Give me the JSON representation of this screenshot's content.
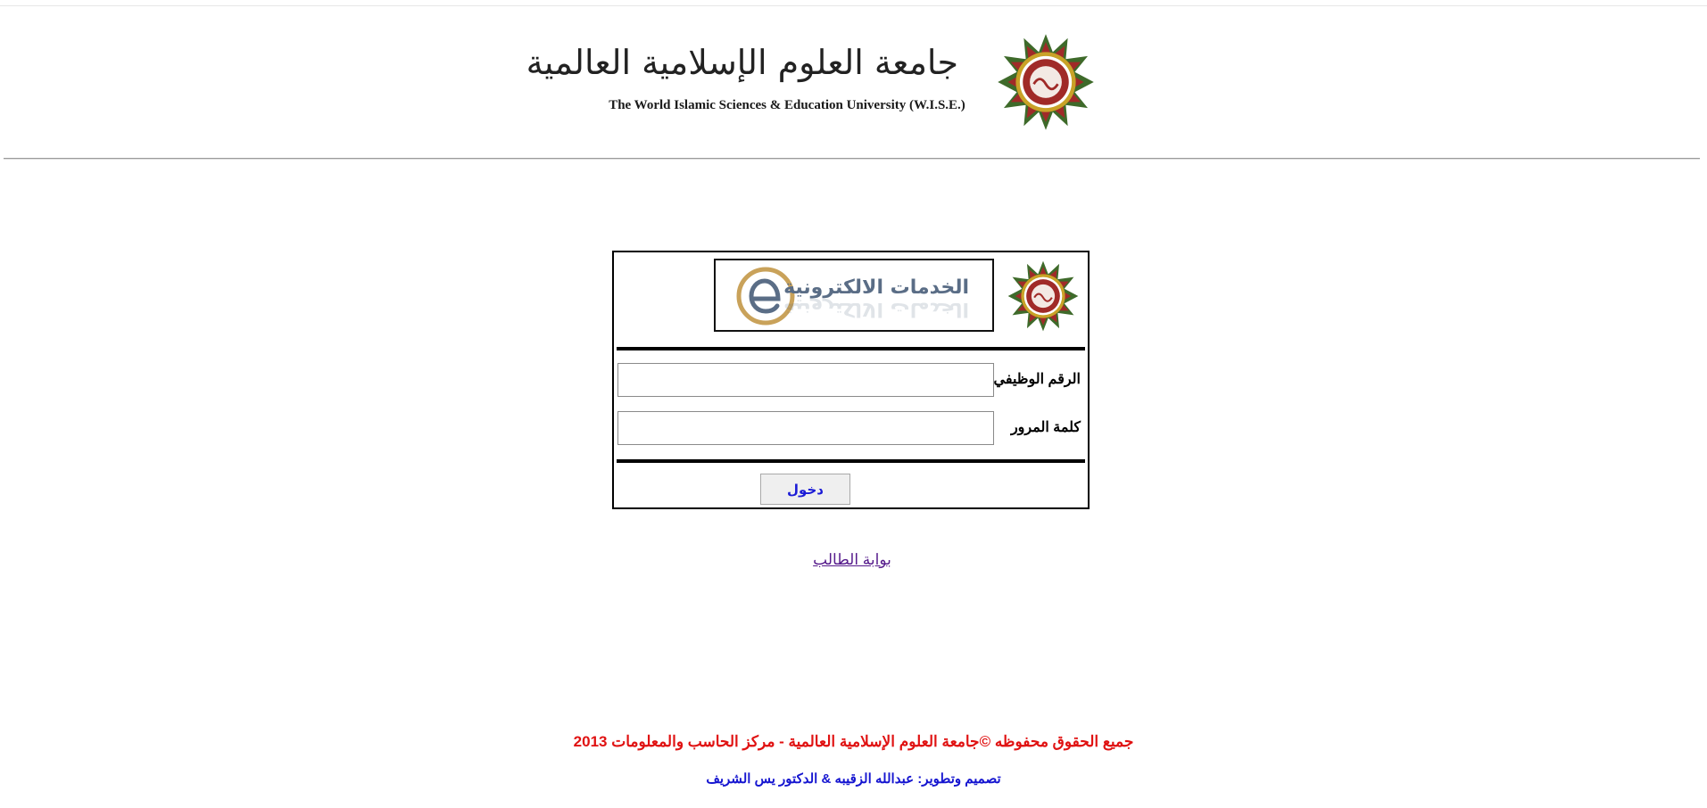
{
  "header": {
    "title_ar": "جامعة العلوم الإسلامية العالمية",
    "title_en": "The World Islamic Sciences & Education University (W.I.S.E.)",
    "seal_icon": "university-seal-icon"
  },
  "login": {
    "banner_text": "الخدمات الالكترونية",
    "banner_icon": "e-services-icon",
    "employee_id_label": "الرقم الوظيفي",
    "employee_id_value": "",
    "password_label": "كلمة المرور",
    "password_value": "",
    "submit_label": "دخول"
  },
  "links": {
    "student_portal": "بوابة الطالب"
  },
  "footer": {
    "copyright": "جميع الحقوق محفوظه ©جامعة العلوم الإسلامية العالمية - مركز الحاسب والمعلومات 2013",
    "credits": "تصميم وتطوير: عبدالله الزقيبه & الدكتور يس الشريف"
  },
  "colors": {
    "seal_green": "#3e6a2a",
    "seal_red": "#a02a28",
    "seal_gold": "#c9a227",
    "banner_text": "#5a6d86",
    "link": "#551a8b",
    "footer_red": "#e01212",
    "footer_blue": "#1515d0"
  }
}
